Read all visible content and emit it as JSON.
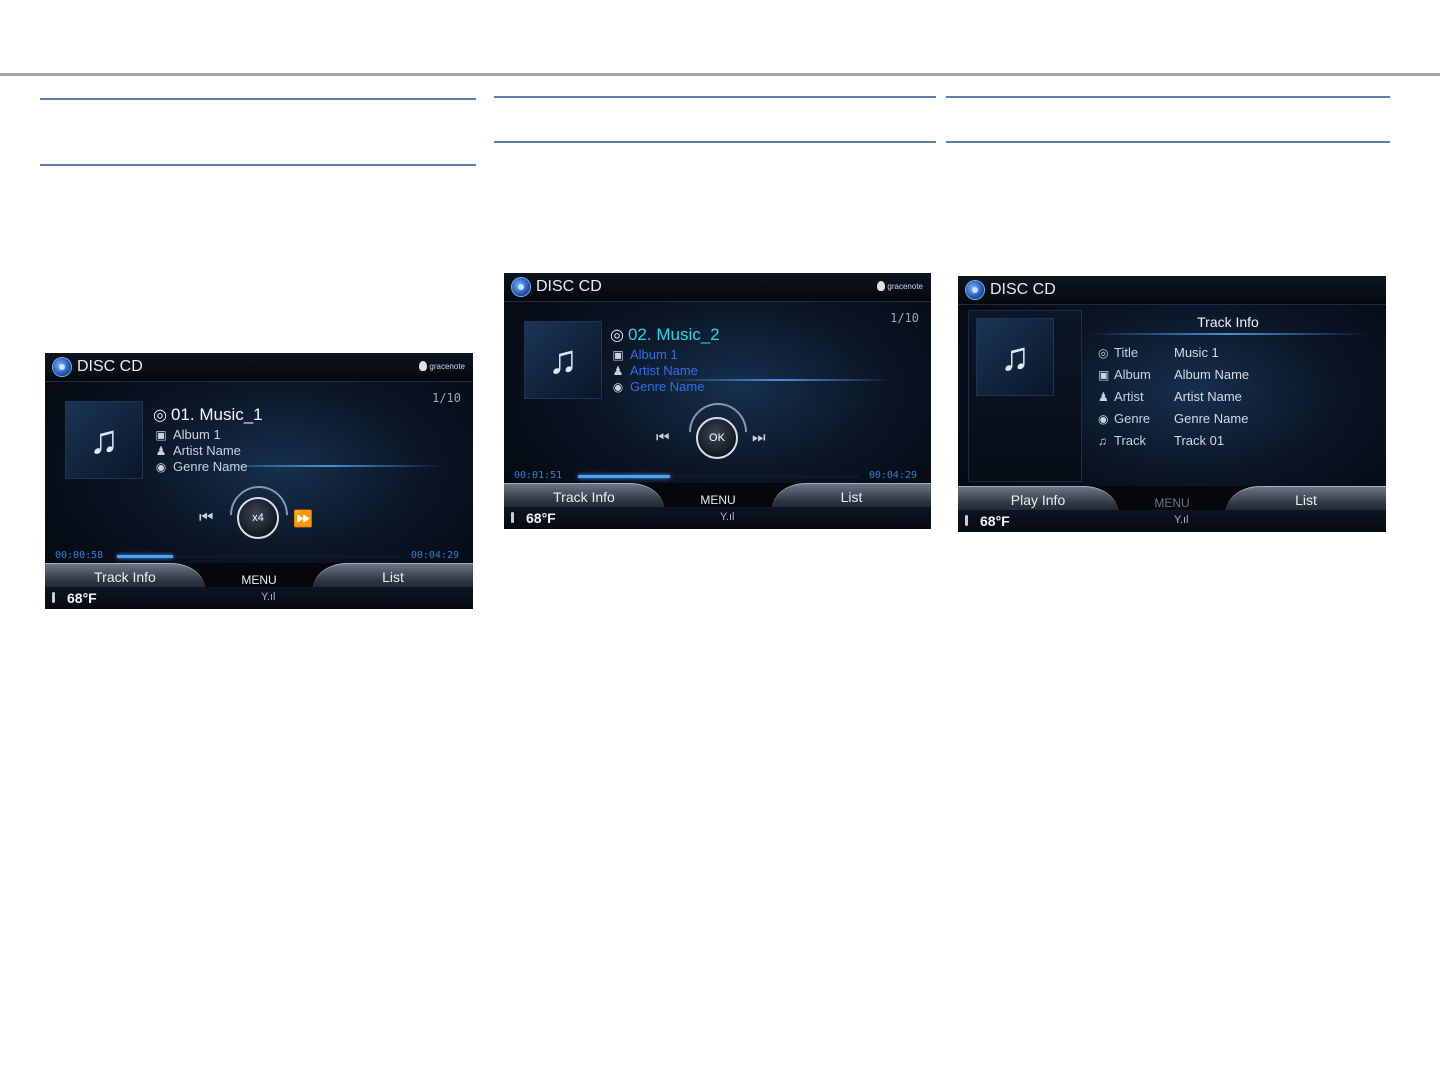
{
  "screens": [
    {
      "title": "DISC CD",
      "brand": "gracenote",
      "counter": "1/10",
      "track": "01. Music_1",
      "album": "Album 1",
      "artist": "Artist Name",
      "genre": "Genre Name",
      "knob_label": "x4",
      "elapsed": "00:00:58",
      "total": "00:04:29",
      "progress": 0.2,
      "tabs": {
        "left": "Track Info",
        "menu": "MENU",
        "right": "List"
      },
      "temperature": "68°F"
    },
    {
      "title": "DISC CD",
      "brand": "gracenote",
      "counter": "1/10",
      "track": "02. Music_2",
      "album": "Album 1",
      "artist": "Artist Name",
      "genre": "Genre Name",
      "knob_label": "OK",
      "elapsed": "00:01:51",
      "total": "00:04:29",
      "progress": 0.33,
      "tabs": {
        "left": "Track Info",
        "menu": "MENU",
        "right": "List"
      },
      "temperature": "68°F"
    },
    {
      "title": "DISC CD",
      "heading": "Track Info",
      "rows": [
        {
          "key": "Title",
          "value": "Music 1",
          "icon": "disc-title-icon"
        },
        {
          "key": "Album",
          "value": "Album Name",
          "icon": "album-icon"
        },
        {
          "key": "Artist",
          "value": "Artist Name",
          "icon": "artist-icon"
        },
        {
          "key": "Genre",
          "value": "Genre Name",
          "icon": "genre-icon"
        },
        {
          "key": "Track",
          "value": "Track 01",
          "icon": "music-note-icon"
        }
      ],
      "tabs": {
        "left": "Play Info",
        "menu": "MENU",
        "right": "List"
      },
      "temperature": "68°F"
    }
  ],
  "colors": {
    "accent_blue": "#2c7ed8",
    "highlight_cyan": "#27d6e6",
    "link_blue": "#2f6fe8"
  }
}
